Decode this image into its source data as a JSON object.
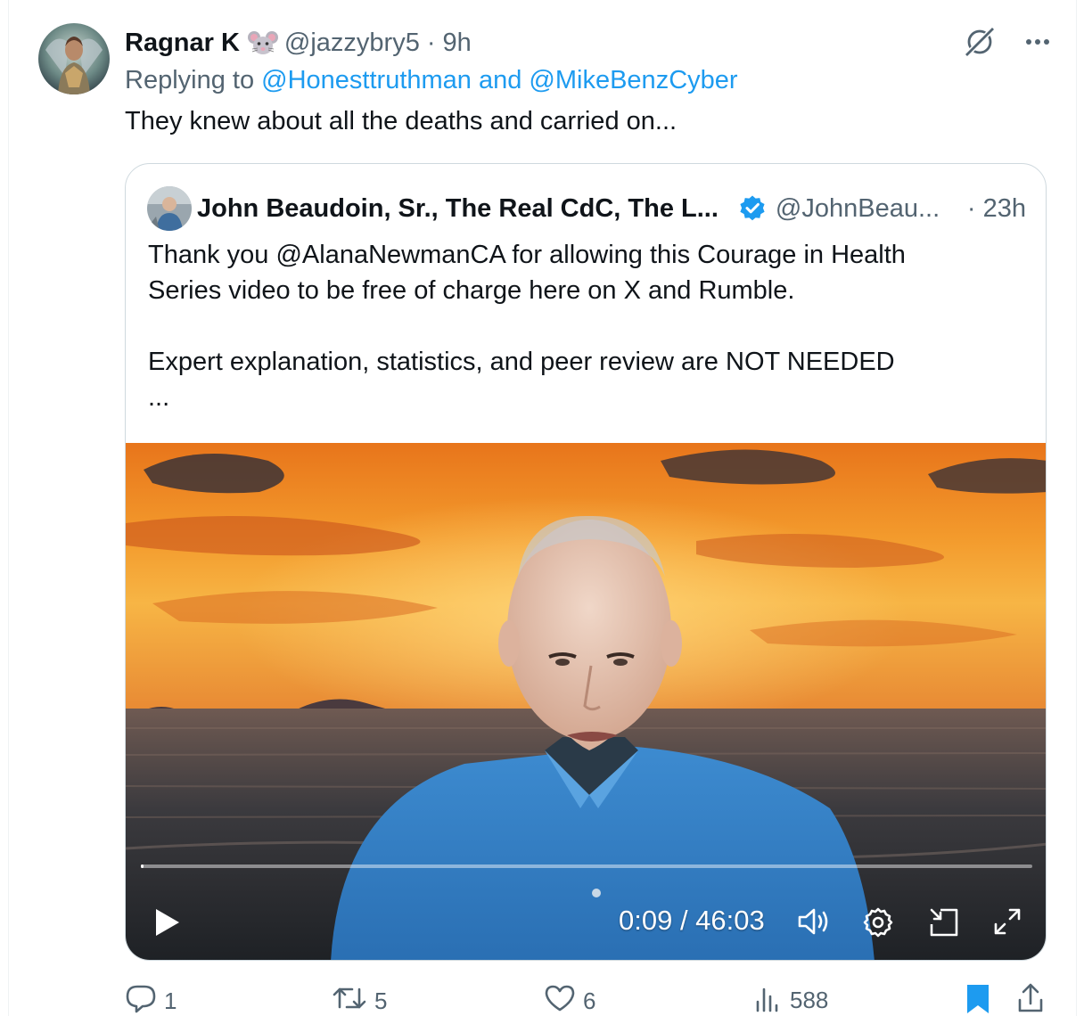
{
  "tweet": {
    "author_name": "Ragnar K",
    "author_handle": "@jazzybry5",
    "dot": "·",
    "time": "9h",
    "replying_prefix": "Replying to",
    "replying_mentions": "@Honesttruthman and @MikeBenzCyber",
    "text": "They knew about all the deaths and carried on..."
  },
  "quote": {
    "author_name": "John Beaudoin, Sr., The Real CdC, The L...",
    "author_handle": "@JohnBeau...",
    "time": "· 23h",
    "body_line1": "Thank you @AlanaNewmanCA for allowing this Courage in Health",
    "body_line2": "Series video to be free of charge here on X and Rumble.",
    "body_line3": "Expert explanation, statistics, and peer review are NOT NEEDED",
    "body_line4": "...",
    "video": {
      "timecode": "0:09 / 46:03",
      "progress_fraction": 0.003
    }
  },
  "actions": {
    "replies": "1",
    "reposts": "5",
    "likes": "6",
    "views": "588"
  },
  "icons": {
    "mouse": "mouse-emoji-icon",
    "grok": "grok-icon",
    "more": "more-icon",
    "verified": "verified-badge-icon",
    "play": "play-icon",
    "volume": "volume-icon",
    "settings": "settings-icon",
    "minimize": "minimize-icon",
    "fullscreen": "fullscreen-icon",
    "reply": "reply-icon",
    "repost": "repost-icon",
    "like": "like-icon",
    "views": "views-icon",
    "bookmark": "bookmark-icon",
    "share": "share-icon"
  },
  "colors": {
    "accent": "#1d9bf0",
    "secondary_text": "#536471",
    "border": "#cfd9de"
  }
}
